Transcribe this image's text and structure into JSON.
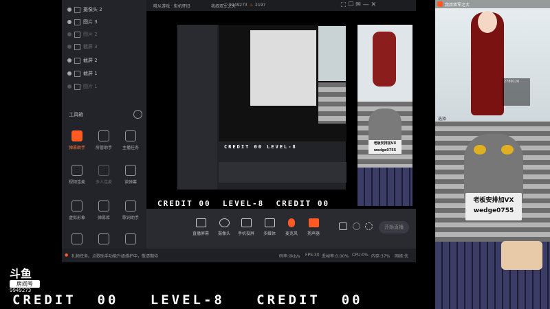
{
  "layers": [
    {
      "label": "摄像头 2",
      "visible": true
    },
    {
      "label": "图片 3",
      "visible": true
    },
    {
      "label": "图片 2",
      "visible": false
    },
    {
      "label": "截屏 3",
      "visible": false
    },
    {
      "label": "截屏 2",
      "visible": true
    },
    {
      "label": "截屏 1",
      "visible": true
    },
    {
      "label": "图片 1",
      "visible": false
    }
  ],
  "toolbox": {
    "title": "工具箱",
    "items": [
      {
        "label": "弹幕助手",
        "active": true
      },
      {
        "label": "房管助手",
        "active": false
      },
      {
        "label": "主播任务",
        "active": false
      },
      {
        "label": "视频连麦",
        "active": false
      },
      {
        "label": "多人连麦",
        "active": false
      },
      {
        "label": "读弹幕",
        "active": false
      },
      {
        "label": "虚拟形象",
        "active": false
      },
      {
        "label": "弹幕库",
        "active": false
      },
      {
        "label": "歌词助手",
        "active": false
      }
    ]
  },
  "topbar": {
    "category": "唯从游戏 · 街机怀旧",
    "room_title": "我叔双军之大",
    "room_id": "9949273",
    "heat": "2197"
  },
  "game": {
    "credit_label": "CREDIT",
    "credit_value": "00",
    "level_label": "LEVEL-8"
  },
  "bottombar": {
    "buttons": [
      "直播屏幕",
      "摄像头",
      "手机投屏",
      "多媒体",
      "麦克风",
      "扬声器"
    ],
    "start_label": "开始直播"
  },
  "statusbar": {
    "notice": "礼物任务。点歌助手功能升级维护中，敬请期待",
    "stats": [
      "码率:0kb/s",
      "FPS:30",
      "丢帧率:0.00%",
      "CPU:0%",
      "内存:37%",
      "网络:优"
    ]
  },
  "logo": {
    "brand": "斗鱼",
    "sub": "房间号",
    "room": "9949273"
  },
  "anime_cam": {
    "name": "我叔双军之大",
    "stat_value": "2789126",
    "stat2": "选择"
  },
  "cat_cam": {
    "line1": "老板安排加VX",
    "line2": "wedge0755"
  },
  "colors": {
    "accent": "#ff5a24"
  }
}
